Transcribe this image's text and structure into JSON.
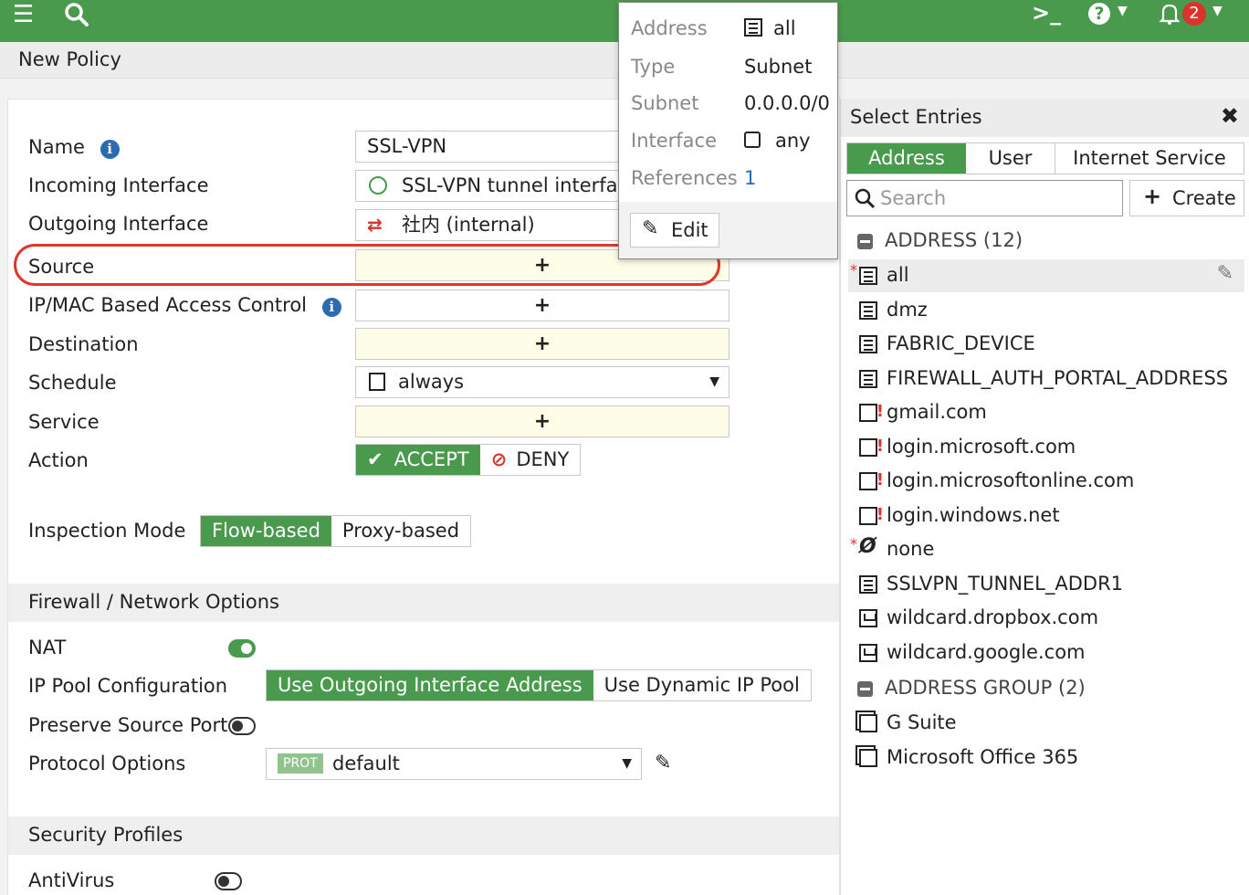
{
  "topbar": {
    "menu_icon": "hamburger-icon",
    "search_icon": "search-icon",
    "cli_icon": "terminal-icon",
    "help_icon": "help-icon",
    "notifications_icon": "bell-icon",
    "notification_count": "2"
  },
  "page": {
    "title": "New Policy"
  },
  "form": {
    "name_label": "Name",
    "name_value": "SSL-VPN",
    "incoming_label": "Incoming Interface",
    "incoming_value": "SSL-VPN tunnel interface",
    "outgoing_label": "Outgoing Interface",
    "outgoing_value": "社内 (internal)",
    "source_label": "Source",
    "ipmac_label": "IP/MAC Based Access Control",
    "destination_label": "Destination",
    "schedule_label": "Schedule",
    "schedule_value": "always",
    "service_label": "Service",
    "action_label": "Action",
    "accept_label": "ACCEPT",
    "deny_label": "DENY",
    "plus": "+",
    "inspection_label": "Inspection Mode",
    "flow_based": "Flow-based",
    "proxy_based": "Proxy-based"
  },
  "firewall_section": {
    "title": "Firewall / Network Options",
    "nat_label": "NAT",
    "nat_enabled": true,
    "ippool_label": "IP Pool Configuration",
    "use_outgoing": "Use Outgoing Interface Address",
    "use_dynamic": "Use Dynamic IP Pool",
    "preserve_label": "Preserve Source Port",
    "preserve_enabled": false,
    "protocol_label": "Protocol Options",
    "protocol_badge": "PROT",
    "protocol_value": "default"
  },
  "security_section": {
    "title": "Security Profiles",
    "antivirus_label": "AntiVirus",
    "antivirus_enabled": false
  },
  "popup": {
    "address_key": "Address",
    "address_val": "all",
    "type_key": "Type",
    "type_val": "Subnet",
    "subnet_key": "Subnet",
    "subnet_val": "0.0.0.0/0",
    "interface_key": "Interface",
    "interface_val": "any",
    "references_key": "References",
    "references_val": "1",
    "edit_label": "Edit"
  },
  "select_entries": {
    "title": "Select Entries",
    "tabs": [
      "Address",
      "User",
      "Internet Service"
    ],
    "search_placeholder": "Search",
    "create_label": "Create",
    "address_group_header": "ADDRESS (12)",
    "addresses": [
      {
        "name": "all",
        "icon": "address-icon",
        "required": true
      },
      {
        "name": "dmz",
        "icon": "address-icon",
        "required": false
      },
      {
        "name": "FABRIC_DEVICE",
        "icon": "address-icon",
        "required": false
      },
      {
        "name": "FIREWALL_AUTH_PORTAL_ADDRESS",
        "icon": "address-icon",
        "required": false
      },
      {
        "name": "gmail.com",
        "icon": "fqdn-icon",
        "required": false
      },
      {
        "name": "login.microsoft.com",
        "icon": "fqdn-icon",
        "required": false
      },
      {
        "name": "login.microsoftonline.com",
        "icon": "fqdn-icon",
        "required": false
      },
      {
        "name": "login.windows.net",
        "icon": "fqdn-icon",
        "required": false
      },
      {
        "name": "none",
        "icon": "none-icon",
        "required": true
      },
      {
        "name": "SSLVPN_TUNNEL_ADDR1",
        "icon": "range-icon",
        "required": false
      },
      {
        "name": "wildcard.dropbox.com",
        "icon": "wildcard-icon",
        "required": false
      },
      {
        "name": "wildcard.google.com",
        "icon": "wildcard-icon",
        "required": false
      }
    ],
    "group_header": "ADDRESS GROUP (2)",
    "groups": [
      {
        "name": "G Suite",
        "icon": "group-icon"
      },
      {
        "name": "Microsoft Office 365",
        "icon": "group-icon"
      }
    ]
  },
  "colors": {
    "brand": "#4a9a4e",
    "highlight": "#e0362c",
    "deny": "#d9342b",
    "link": "#2b6cb0"
  }
}
